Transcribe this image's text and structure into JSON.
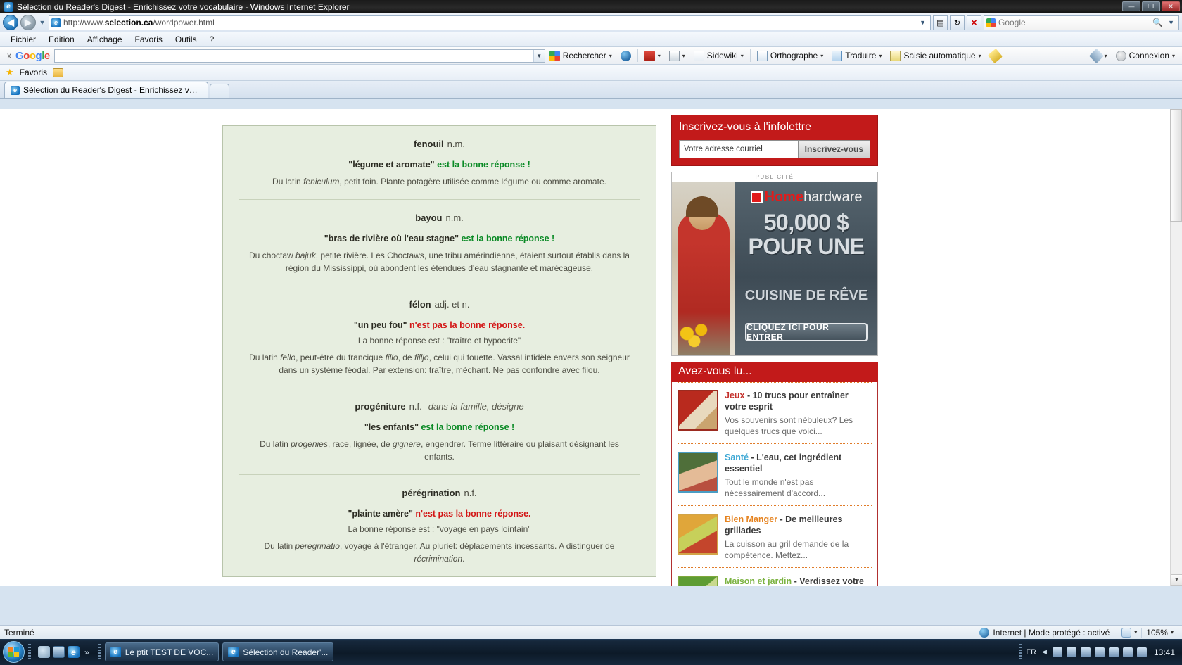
{
  "window": {
    "title": "Sélection du Reader's Digest - Enrichissez votre vocabulaire - Windows Internet Explorer",
    "ie_glyph": "e",
    "minimize": "—",
    "maximize": "❐",
    "close": "✕"
  },
  "address_bar": {
    "url_prefix": "http://www.",
    "url_domain": "selection.ca",
    "url_suffix": "/wordpower.html",
    "back_glyph": "◀",
    "forward_glyph": "▶",
    "history_glyph": "▼",
    "refresh_glyph": "↻",
    "stop_glyph": "✕",
    "compat_glyph": "▤",
    "search_placeholder": "Google",
    "search_glyph": "🔍",
    "search_drop": "▼"
  },
  "menubar": {
    "items": [
      "Fichier",
      "Edition",
      "Affichage",
      "Favoris",
      "Outils",
      "?"
    ]
  },
  "google_toolbar": {
    "close_label": "x",
    "logo_letters": [
      "G",
      "o",
      "o",
      "g",
      "l",
      "e"
    ],
    "input_value": "",
    "buttons": [
      {
        "label": "Rechercher",
        "icon": "google-search-icon",
        "caret": "▾"
      },
      {
        "label": "",
        "icon": "globe-icon",
        "caret": ""
      },
      {
        "label": "",
        "icon": "bookmark-icon",
        "caret": "▾"
      },
      {
        "label": "",
        "icon": "page-icon",
        "caret": "▾"
      },
      {
        "label": "Sidewiki",
        "icon": "sidewiki-icon",
        "caret": "▾"
      },
      {
        "label": "Orthographe",
        "icon": "abc-check-icon",
        "caret": "▾"
      },
      {
        "label": "Traduire",
        "icon": "translate-icon",
        "caret": "▾"
      },
      {
        "label": "Saisie automatique",
        "icon": "autofill-icon",
        "caret": "▾"
      },
      {
        "label": "",
        "icon": "highlighter-pencil-icon",
        "caret": ""
      }
    ],
    "settings_caret": "▾",
    "connection_label": "Connexion",
    "connection_caret": "▾"
  },
  "favorites_bar": {
    "label": "Favoris",
    "star_glyph": "★"
  },
  "tabs": {
    "items": [
      {
        "label": "Sélection du Reader's Digest - Enrichissez votre v...",
        "active": true
      }
    ],
    "new_tab_label": ""
  },
  "page": {
    "words": [
      {
        "term": "fenouil",
        "pos": "n.m.",
        "note": "",
        "answer_quote": "\"légume et aromate\"",
        "answer_verdict": "est la bonne réponse !",
        "verdict_type": "correct",
        "correct_line": "",
        "etymology_parts": [
          {
            "t": "Du latin ",
            "i": false
          },
          {
            "t": "feniculum",
            "i": true
          },
          {
            "t": ", petit foin. Plante potagère utilisée comme légume ou comme aromate.",
            "i": false
          }
        ]
      },
      {
        "term": "bayou",
        "pos": "n.m.",
        "note": "",
        "answer_quote": "\"bras de rivière où l'eau stagne\"",
        "answer_verdict": "est la bonne réponse !",
        "verdict_type": "correct",
        "correct_line": "",
        "etymology_parts": [
          {
            "t": "Du choctaw ",
            "i": false
          },
          {
            "t": "bajuk",
            "i": true
          },
          {
            "t": ", petite rivière. Les Choctaws, une tribu amérindienne, étaient surtout établis dans la région du Mississippi, où abondent les étendues d'eau stagnante et marécageuse.",
            "i": false
          }
        ]
      },
      {
        "term": "félon",
        "pos": "adj. et n.",
        "note": "",
        "answer_quote": "\"un peu fou\"",
        "answer_verdict": "n'est pas la bonne réponse.",
        "verdict_type": "wrong",
        "correct_line": "La bonne réponse est : \"traître et hypocrite\"",
        "etymology_parts": [
          {
            "t": "Du latin ",
            "i": false
          },
          {
            "t": "fello",
            "i": true
          },
          {
            "t": ", peut-être du francique ",
            "i": false
          },
          {
            "t": "fillo",
            "i": true
          },
          {
            "t": ", de ",
            "i": false
          },
          {
            "t": "filljo",
            "i": true
          },
          {
            "t": ", celui qui fouette. Vassal infidèle envers son seigneur dans un système féodal. Par extension: traître, méchant. Ne pas confondre avec filou.",
            "i": false
          }
        ]
      },
      {
        "term": "progéniture",
        "pos": "n.f.",
        "note": "dans la famille, désigne",
        "answer_quote": "\"les enfants\"",
        "answer_verdict": "est la bonne réponse !",
        "verdict_type": "correct",
        "correct_line": "",
        "etymology_parts": [
          {
            "t": "Du latin ",
            "i": false
          },
          {
            "t": "progenies",
            "i": true
          },
          {
            "t": ", race, lignée, de ",
            "i": false
          },
          {
            "t": "gignere",
            "i": true
          },
          {
            "t": ", engendrer. Terme littéraire ou plaisant désignant les enfants.",
            "i": false
          }
        ]
      },
      {
        "term": "pérégrination",
        "pos": "n.f.",
        "note": "",
        "answer_quote": "\"plainte amère\"",
        "answer_verdict": "n'est pas la bonne réponse.",
        "verdict_type": "wrong",
        "correct_line": "La bonne réponse est : \"voyage en pays lointain\"",
        "etymology_parts": [
          {
            "t": "Du latin ",
            "i": false
          },
          {
            "t": "peregrinatio",
            "i": true
          },
          {
            "t": ", voyage à l'étranger. Au pluriel: déplacements incessants. A distinguer de ",
            "i": false
          },
          {
            "t": "récrimination",
            "i": true
          },
          {
            "t": ".",
            "i": false
          }
        ]
      }
    ],
    "newsletter": {
      "title": "Inscrivez-vous à l'infolettre",
      "input_placeholder": "Votre adresse courriel",
      "button_label": "Inscrivez-vous"
    },
    "ad": {
      "label": "PUBLICITÉ",
      "brand_home": "Home",
      "brand_hardware": "hardware",
      "headline_line1": "50,000 $",
      "headline_line2": "POUR UNE",
      "subline": "CUISINE DE RÊVE",
      "cta": "CLIQUEZ ICI POUR ENTRER"
    },
    "read_section": {
      "title": "Avez-vous lu...",
      "items": [
        {
          "category": "Jeux",
          "category_color": "#c4302b",
          "headline": " - 10 trucs pour entraîner votre esprit",
          "description": "Vos souvenirs sont nébuleux? Les quelques trucs que voici...",
          "thumb": "book-thumbnail"
        },
        {
          "category": "Santé",
          "category_color": "#3ba7d4",
          "headline": " - L'eau, cet ingrédient essentiel",
          "description": "Tout le monde n'est pas nécessairement d'accord...",
          "thumb": "drinking-water-thumbnail"
        },
        {
          "category": "Bien Manger",
          "category_color": "#e5821e",
          "headline": " - De meilleures grillades",
          "description": "La cuisson au gril demande de la compétence. Mettez...",
          "thumb": "grilled-food-thumbnail"
        },
        {
          "category": "Maison et jardin",
          "category_color": "#7cb342",
          "headline": " - Verdissez votre intérieur",
          "description": "",
          "thumb": "plant-thumbnail"
        }
      ]
    }
  },
  "statusbar": {
    "status_text": "Terminé",
    "zone_text": "Internet | Mode protégé : activé",
    "zoom_level": "105%",
    "zoom_caret": "▾",
    "zone_caret": "▾"
  },
  "taskbar": {
    "start_label": "",
    "quick_launch_chevron": "»",
    "items": [
      {
        "label": "Le ptit TEST DE VOC...",
        "active": false
      },
      {
        "label": "Sélection du Reader'...",
        "active": false
      }
    ],
    "tray_language": "FR",
    "tray_clock": "13:41",
    "tray_arrows": "◀"
  },
  "scrollbar": {
    "up_glyph": "▲",
    "down_glyph": "▼"
  }
}
